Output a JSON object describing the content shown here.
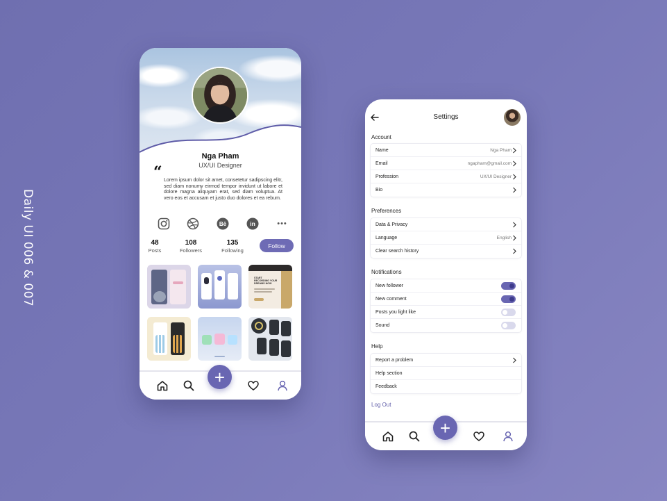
{
  "side_title": "Daily UI 006 & 007",
  "colors": {
    "accent": "#6966b2",
    "background": "#7474b6"
  },
  "profile": {
    "name": "Nga Pham",
    "role": "UX/UI Designer",
    "quote_mark": "“",
    "bio": "Lorem ipsum dolor sit amet, consetetur sadipscing elitr, sed diam nonumy eirmod tempor invidunt ut labore et dolore magna aliquyam erat, sed diam voluptua. At vero eos et accusam et justo duo dolores et ea rebum.",
    "socials": {
      "instagram": "instagram-icon",
      "dribbble": "dribbble-icon",
      "behance": "Bē",
      "linkedin": "in",
      "more": "•••"
    },
    "stats": [
      {
        "value": "48",
        "label": "Posts"
      },
      {
        "value": "108",
        "label": "Followers"
      },
      {
        "value": "135",
        "label": "Following"
      }
    ],
    "follow_label": "Follow",
    "thumb_texts": {
      "t3_headline": "START RECORDING YOUR DREAMS NOW"
    }
  },
  "settings": {
    "title": "Settings",
    "sections": {
      "account": {
        "label": "Account",
        "rows": [
          {
            "label": "Name",
            "value": "Nga Pham"
          },
          {
            "label": "Email",
            "value": "ngapham@gmail.com"
          },
          {
            "label": "Profession",
            "value": "UX/UI Designer"
          },
          {
            "label": "Bio",
            "value": ""
          }
        ]
      },
      "preferences": {
        "label": "Preferences",
        "rows": [
          {
            "label": "Data & Privacy",
            "value": ""
          },
          {
            "label": "Language",
            "value": "English"
          },
          {
            "label": "Clear search history",
            "value": ""
          }
        ]
      },
      "notifications": {
        "label": "Notifications",
        "rows": [
          {
            "label": "New follower",
            "state": "on"
          },
          {
            "label": "New comment",
            "state": "on"
          },
          {
            "label": "Posts you light like",
            "state": "off"
          },
          {
            "label": "Sound",
            "state": "off"
          }
        ]
      },
      "help": {
        "label": "Help",
        "rows": [
          {
            "label": "Report a problem"
          },
          {
            "label": "Help section"
          },
          {
            "label": "Feedback"
          }
        ]
      }
    },
    "logout_label": "Log Out"
  },
  "nav": {
    "items": [
      "home-icon",
      "search-icon",
      "add-icon",
      "heart-icon",
      "profile-icon"
    ],
    "fab_label": "+"
  }
}
